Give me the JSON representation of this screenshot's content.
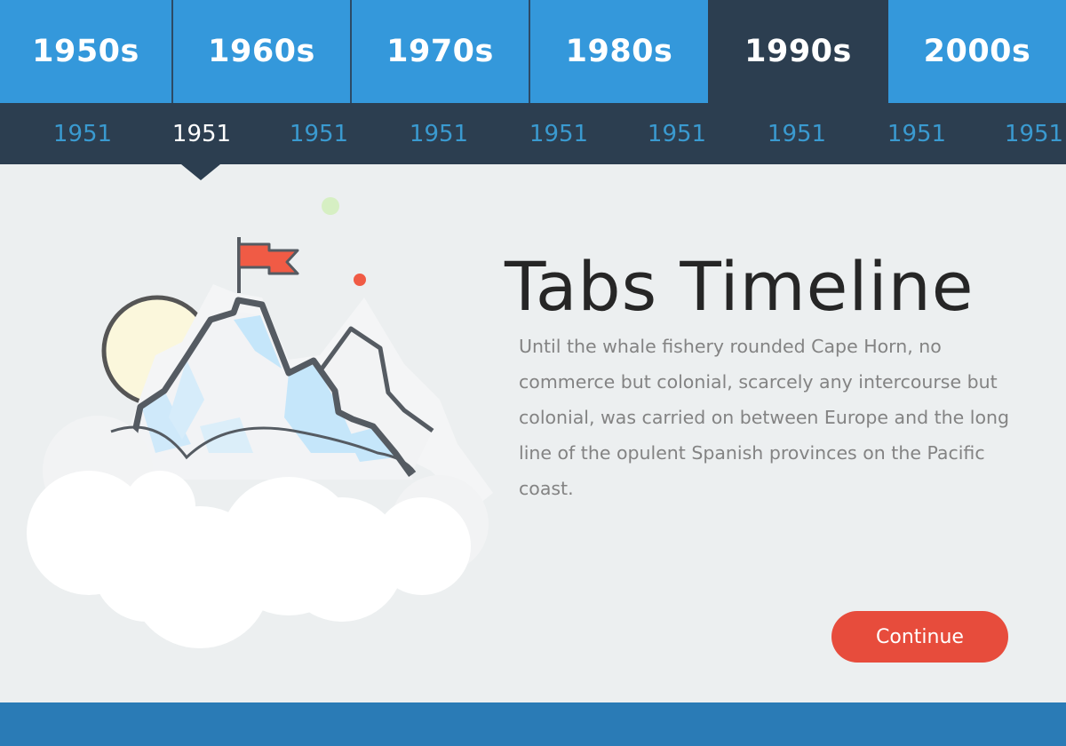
{
  "decade_tabs": [
    {
      "label": "1950s",
      "active": false
    },
    {
      "label": "1960s",
      "active": false
    },
    {
      "label": "1970s",
      "active": false
    },
    {
      "label": "1980s",
      "active": false
    },
    {
      "label": "1990s",
      "active": true
    },
    {
      "label": "2000s",
      "active": false
    }
  ],
  "year_tabs": [
    {
      "label": "1951",
      "active": false
    },
    {
      "label": "1951",
      "active": true
    },
    {
      "label": "1951",
      "active": false
    },
    {
      "label": "1951",
      "active": false
    },
    {
      "label": "1951",
      "active": false
    },
    {
      "label": "1951",
      "active": false
    },
    {
      "label": "1951",
      "active": false
    },
    {
      "label": "1951",
      "active": false
    },
    {
      "label": "1951",
      "active": false
    }
  ],
  "content": {
    "title": "Tabs Timeline",
    "body": "Until the whale fishery rounded Cape Horn, no commerce but colonial, scarcely any intercourse but colonial, was carried on between Europe and the long line of the opulent Spanish provinces on the Pacific coast.",
    "continue_label": "Continue"
  },
  "illustration": {
    "icon": "mountain-flag-illustration"
  },
  "colors": {
    "primary_blue": "#3498db",
    "dark_navy": "#2c3e50",
    "accent_red": "#e74c3c",
    "footer_blue": "#2a7bb6",
    "background": "#eceff0"
  }
}
